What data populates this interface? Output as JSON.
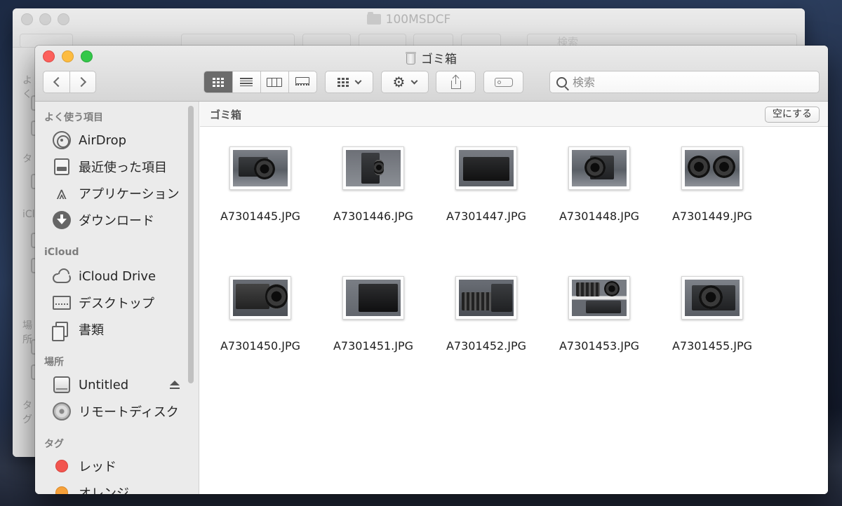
{
  "background_window": {
    "title": "100MSDCF",
    "search_placeholder": "検索",
    "sidebar_fragments": [
      "よく",
      "タ",
      "iCl",
      "場所",
      "タグ"
    ]
  },
  "window": {
    "title": "ゴミ箱",
    "title_icon": "trash-icon"
  },
  "toolbar": {
    "back_icon": "chevron-left-icon",
    "forward_icon": "chevron-right-icon",
    "view_modes": [
      "icon",
      "list",
      "column",
      "gallery"
    ],
    "active_view": "icon",
    "arrange_icon": "grid-icon",
    "action_icon": "gear-icon",
    "share_icon": "share-icon",
    "tag_icon": "tag-icon",
    "search_placeholder": "検索"
  },
  "sidebar": {
    "favorites_header": "よく使う項目",
    "favorites": [
      {
        "label": "AirDrop",
        "icon": "airdrop-icon"
      },
      {
        "label": "最近使った項目",
        "icon": "recents-icon"
      },
      {
        "label": "アプリケーション",
        "icon": "applications-icon"
      },
      {
        "label": "ダウンロード",
        "icon": "downloads-icon"
      }
    ],
    "icloud_header": "iCloud",
    "icloud": [
      {
        "label": "iCloud Drive",
        "icon": "cloud-icon"
      },
      {
        "label": "デスクトップ",
        "icon": "desktop-icon"
      },
      {
        "label": "書類",
        "icon": "documents-icon"
      }
    ],
    "locations_header": "場所",
    "locations": [
      {
        "label": "Untitled",
        "icon": "disk-icon",
        "ejectable": true
      },
      {
        "label": "リモートディスク",
        "icon": "remote-disc-icon"
      }
    ],
    "tags_header": "タグ",
    "tags": [
      {
        "label": "レッド",
        "color": "#f2554f"
      },
      {
        "label": "オレンジ",
        "color": "#f6a13a"
      }
    ]
  },
  "content": {
    "path_title": "ゴミ箱",
    "empty_button": "空にする",
    "files": [
      {
        "name": "A7301445.JPG"
      },
      {
        "name": "A7301446.JPG"
      },
      {
        "name": "A7301447.JPG"
      },
      {
        "name": "A7301448.JPG"
      },
      {
        "name": "A7301449.JPG"
      },
      {
        "name": "A7301450.JPG"
      },
      {
        "name": "A7301451.JPG"
      },
      {
        "name": "A7301452.JPG"
      },
      {
        "name": "A7301453.JPG"
      },
      {
        "name": "A7301455.JPG"
      }
    ]
  },
  "colors": {
    "close": "#fc605c",
    "minimize": "#fdbc40",
    "zoom": "#34c84a",
    "active_segment": "#6b6b6b"
  }
}
